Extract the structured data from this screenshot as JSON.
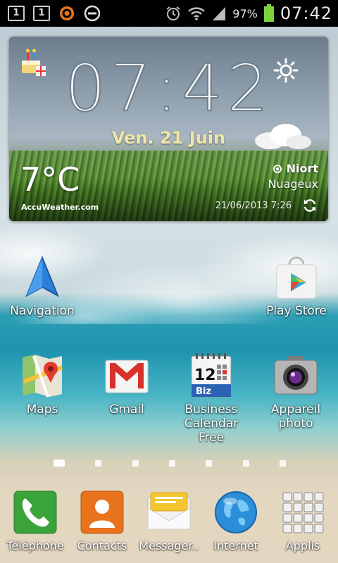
{
  "status_bar": {
    "sim1": "1",
    "sim2": "1",
    "battery_percent": "97%",
    "time": "07:42"
  },
  "weather": {
    "clock": "07:42",
    "date": "Ven. 21 Juin",
    "temperature": "7°C",
    "city": "Niort",
    "condition": "Nuageux",
    "updated": "21/06/2013 7:26",
    "brand": "AccuWeather.com"
  },
  "home_apps": [
    {
      "label": "Navigation"
    },
    {
      "label": "Play Store"
    },
    {
      "label": "Maps"
    },
    {
      "label": "Gmail"
    },
    {
      "label_line1": "Business",
      "label_line2": "Calendar Free",
      "icon_text_day": "12",
      "icon_text_brand": "Biz"
    },
    {
      "label_line1": "Appareil",
      "label_line2": "photo"
    }
  ],
  "pager": {
    "pages": 7,
    "active_index": 0
  },
  "dock": [
    {
      "label": "Téléphone"
    },
    {
      "label": "Contacts"
    },
    {
      "label": "Messager.."
    },
    {
      "label": "Internet"
    },
    {
      "label": "Applis"
    }
  ],
  "colors": {
    "status_bar_bg": "#000000",
    "date_text": "#f2e6a6",
    "battery": "#7cd23a",
    "phone_icon": "#3aa33a",
    "contacts_icon": "#e8731c",
    "messages_icon": "#f2c531"
  }
}
